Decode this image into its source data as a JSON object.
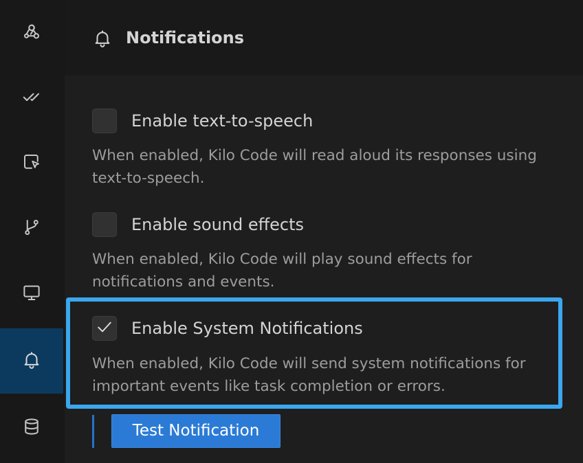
{
  "sidebar": {
    "items": [
      {
        "icon": "webhook-icon",
        "active": false
      },
      {
        "icon": "check-all-icon",
        "active": false
      },
      {
        "icon": "pointer-select-icon",
        "active": false
      },
      {
        "icon": "git-branch-icon",
        "active": false
      },
      {
        "icon": "monitor-icon",
        "active": false
      },
      {
        "icon": "bell-icon",
        "active": true
      },
      {
        "icon": "database-icon",
        "active": false
      }
    ]
  },
  "header": {
    "icon": "bell-icon",
    "title": "Notifications"
  },
  "settings": [
    {
      "label": "Enable text-to-speech",
      "checked": false,
      "description": "When enabled, Kilo Code will read aloud its responses using text-to-speech."
    },
    {
      "label": "Enable sound effects",
      "checked": false,
      "description": "When enabled, Kilo Code will play sound effects for notifications and events."
    },
    {
      "label": "Enable System Notifications",
      "checked": true,
      "description": "When enabled, Kilo Code will send system notifications for important events like task completion or errors."
    }
  ],
  "test_button_label": "Test Notification",
  "colors": {
    "highlight_border": "#3ba7ef",
    "button_bg": "#2b7bd6",
    "active_sidebar_bg": "#0c3a5f"
  }
}
